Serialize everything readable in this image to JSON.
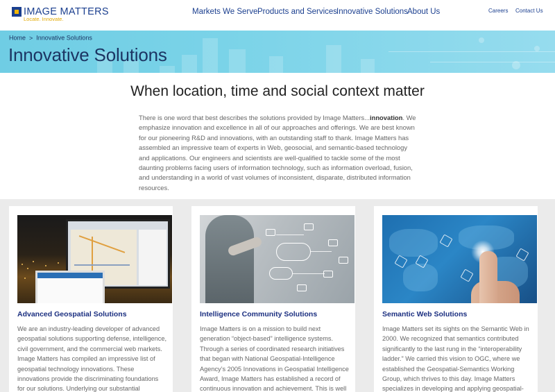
{
  "header": {
    "logo_name": "IMAGE MATTERS",
    "logo_tagline": "Locate. Innovate.",
    "nav": [
      "Markets We Serve",
      "Products and Services",
      "Innovative Solutions",
      "About Us"
    ],
    "utility": [
      "Careers",
      "Contact Us"
    ]
  },
  "banner": {
    "breadcrumb": [
      "Home",
      "Innovative Solutions"
    ],
    "breadcrumb_separator": ">",
    "title": "Innovative Solutions"
  },
  "intro": {
    "heading": "When location, time and social context matter",
    "body_before": "There is one word that best describes the solutions provided by Image Matters...",
    "body_emphasis": "innovation",
    "body_after": ". We emphasize innovation and excellence in all of our approaches and offerings. We are best known for our pioneering R&D and innovations, with an outstanding staff to thank. Image Matters has assembled an impressive team of experts in Web, geosocial, and semantic-based technology and applications. Our engineers and scientists are well-qualified to tackle some of the most daunting problems facing users of information technology, such as information overload, fusion, and understanding in a world of vast volumes of inconsistent, disparate, distributed information resources."
  },
  "cards": [
    {
      "title": "Advanced Geospatial Solutions",
      "text": "We are an industry-leading developer of advanced geospatial solutions supporting defense, intelligence, civil government, and the commercial web markets. Image Matters has compiled an impressive list of geospatial technology innovations. These innovations provide the discriminating foundations for our solutions. Underlying our substantial"
    },
    {
      "title": "Intelligence Community Solutions",
      "text": "Image Matters is on a mission to build next generation “object-based” intelligence systems. Through a series of coordinated research initiatives that began with National Geospatial-Intelligence Agency’s 2005 Innovations in Geospatial Intelligence Award, Image Matters has established a record of continuous innovation and achievement. This is well"
    },
    {
      "title": "Semantic Web Solutions",
      "text": "Image Matters set its sights on the Semantic Web in 2000. We recognized that semantics contributed significantly to the last rung in the “interoperability ladder.” We carried this vision to OGC, where we established the Geospatial-Semantics Working Group, which thrives to this day. Image Matters specializes in developing and applying geospatial-"
    }
  ],
  "colors": {
    "brand_blue": "#1b3f8f",
    "brand_yellow": "#e2a800",
    "banner_cyan": "#7ad3e8",
    "card_title": "#1b2f80"
  }
}
